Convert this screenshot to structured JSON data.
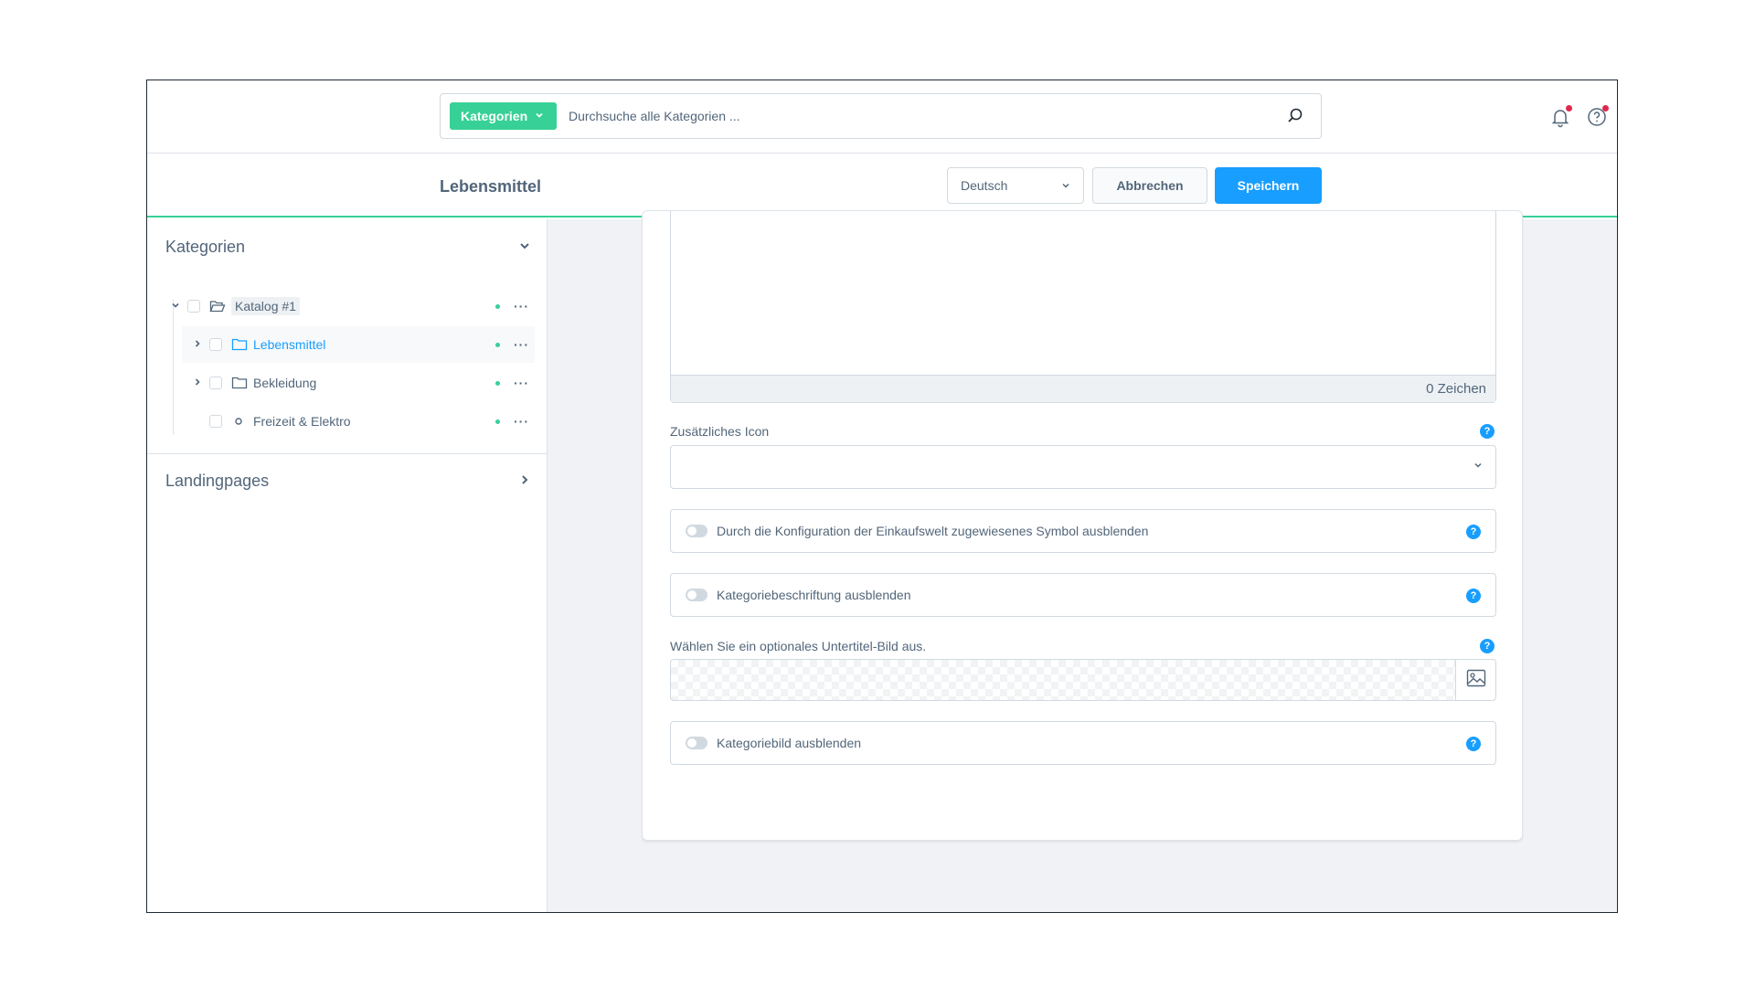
{
  "search": {
    "type_label": "Kategorien",
    "placeholder": "Durchsuche alle Kategorien ..."
  },
  "header": {
    "title": "Lebensmittel",
    "language": "Deutsch",
    "cancel_label": "Abbrechen",
    "save_label": "Speichern"
  },
  "sidebar": {
    "categories_title": "Kategorien",
    "landingpages_title": "Landingpages",
    "tree": [
      {
        "label": "Katalog #1",
        "more": "···"
      },
      {
        "label": "Lebensmittel",
        "more": "···"
      },
      {
        "label": "Bekleidung",
        "more": "···"
      },
      {
        "label": "Freizeit & Elektro",
        "more": "···"
      }
    ]
  },
  "form": {
    "char_count": "0 Zeichen",
    "icon_label": "Zusätzliches Icon",
    "icon_value": "",
    "hide_symbol_label": "Durch die Konfiguration der Einkaufswelt zugewiesenes Symbol ausblenden",
    "hide_caption_label": "Kategoriebeschriftung ausblenden",
    "subtitle_image_label": "Wählen Sie ein optionales Untertitel-Bild aus.",
    "hide_image_label": "Kategoriebild ausblenden",
    "help_glyph": "?"
  },
  "colors": {
    "accent_green": "#37d197",
    "primary_blue": "#189eff",
    "notification_red": "#de294c",
    "text": "#52667a"
  },
  "icons": {
    "search": "search-icon",
    "bell": "bell-icon",
    "help": "help-circle-icon",
    "folder": "folder-icon",
    "folder_open": "folder-open-icon",
    "image": "image-icon"
  }
}
